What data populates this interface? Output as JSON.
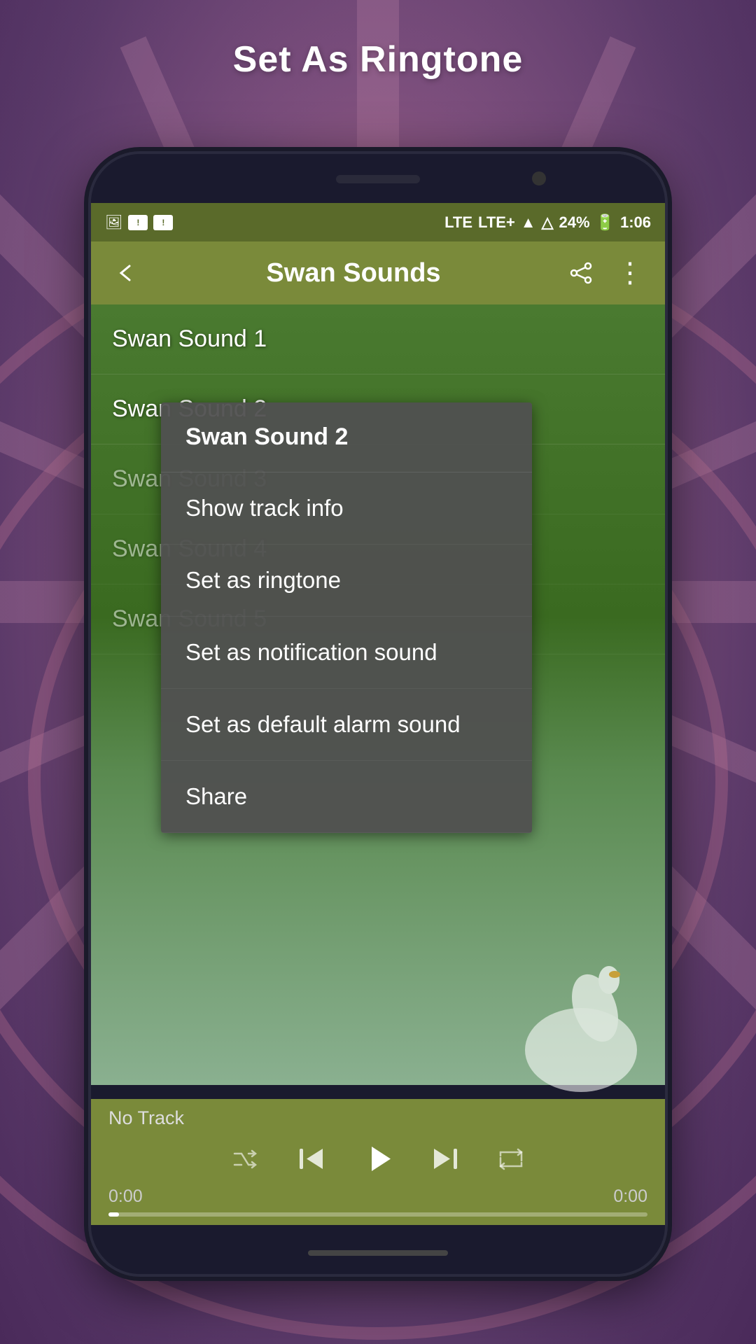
{
  "page": {
    "title": "Set As Ringtone",
    "background_color": "#7a5080"
  },
  "status_bar": {
    "network_lte": "LTE",
    "network_lte2": "LTE+",
    "signal": "▲",
    "battery_percent": "24%",
    "time": "1:06",
    "icons": [
      "notification1",
      "notification2",
      "notification3"
    ]
  },
  "toolbar": {
    "title": "Swan Sounds",
    "back_label": "←",
    "share_label": "share",
    "more_label": "⋮"
  },
  "songs": [
    {
      "id": 1,
      "name": "Swan Sound 1"
    },
    {
      "id": 2,
      "name": "Swan Sound 2"
    },
    {
      "id": 3,
      "name": "Swan Sound 3"
    },
    {
      "id": 4,
      "name": "Swan Sound 4"
    },
    {
      "id": 5,
      "name": "Swan Sound 5"
    }
  ],
  "context_menu": {
    "title": "Swan Sound 2",
    "items": [
      {
        "id": "show-track",
        "label": "Show track info"
      },
      {
        "id": "set-ringtone",
        "label": "Set as ringtone"
      },
      {
        "id": "set-notification",
        "label": "Set as notification sound"
      },
      {
        "id": "set-alarm",
        "label": "Set as default alarm sound"
      },
      {
        "id": "share",
        "label": "Share"
      }
    ]
  },
  "player": {
    "track": "No Track",
    "time_start": "0:00",
    "time_end": "0:00",
    "progress": 0
  }
}
